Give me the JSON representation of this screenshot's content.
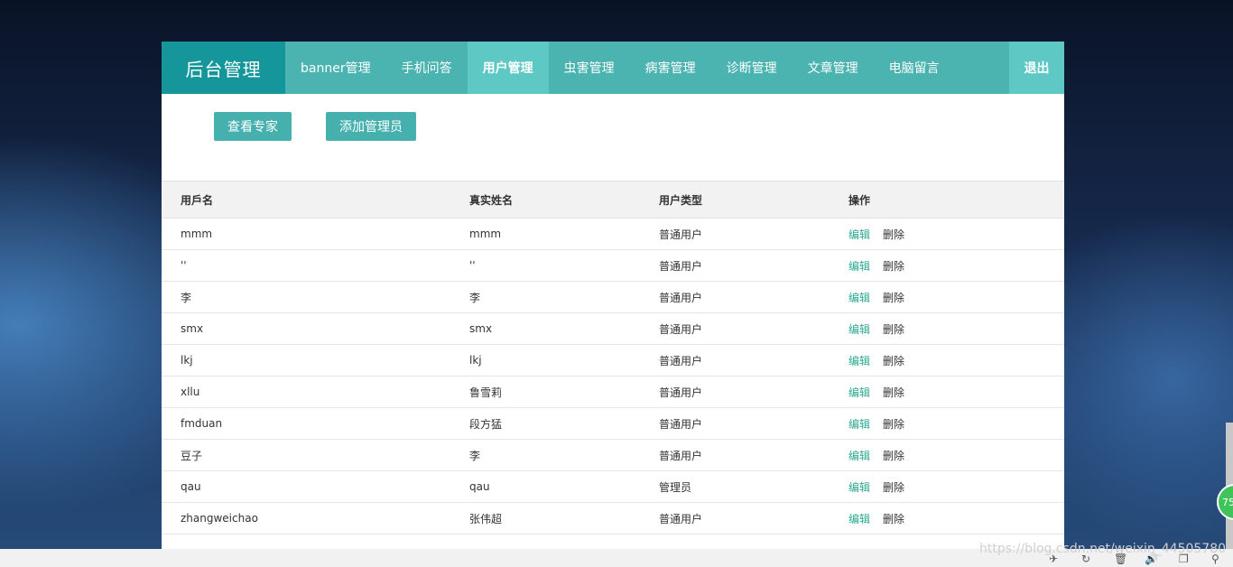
{
  "brand": "后台管理",
  "nav": [
    "banner管理",
    "手机问答",
    "用户管理",
    "虫害管理",
    "病害管理",
    "诊断管理",
    "文章管理",
    "电脑留言"
  ],
  "logout": "退出",
  "buttons": {
    "view_experts": "查看专家",
    "add_admin": "添加管理员"
  },
  "table": {
    "headers": [
      "用戶名",
      "真实姓名",
      "用户类型",
      "操作"
    ],
    "edit_label": "编辑",
    "delete_label": "删除",
    "rows": [
      [
        "mmm",
        "mmm",
        "普通用户"
      ],
      [
        "''",
        "''",
        "普通用户"
      ],
      [
        "李",
        "李",
        "普通用户"
      ],
      [
        "smx",
        "smx",
        "普通用户"
      ],
      [
        "lkj",
        "lkj",
        "普通用户"
      ],
      [
        "xllu",
        "鲁雪莉",
        "普通用户"
      ],
      [
        "fmduan",
        "段方猛",
        "普通用户"
      ],
      [
        "豆子",
        "李",
        "普通用户"
      ],
      [
        "qau",
        "qau",
        "管理员"
      ],
      [
        "zhangweichao",
        "张伟超",
        "普通用户"
      ]
    ]
  },
  "watermark": "https://blog.csdn.net/weixin_44505780",
  "badge": "75",
  "theme": {
    "accent": "#46b0ae",
    "brand_bg": "#14969a",
    "active_bg": "#5ec8c4",
    "edit_color": "#2ba893"
  }
}
